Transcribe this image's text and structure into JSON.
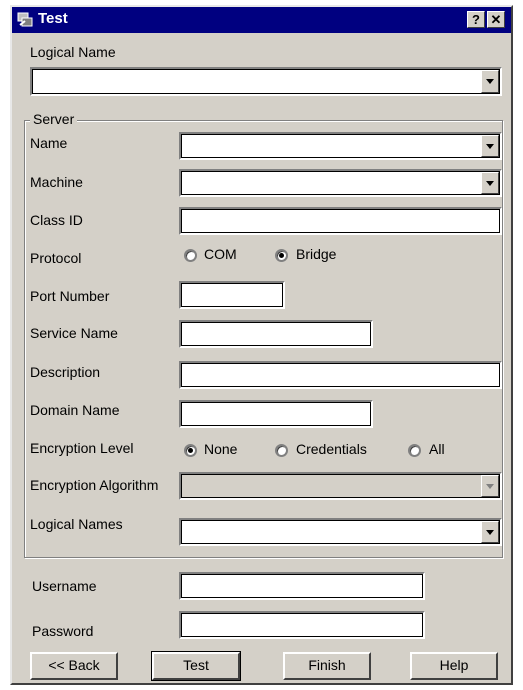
{
  "window": {
    "title": "Test",
    "help_button": "?",
    "close_button": "✕"
  },
  "logical_name": {
    "label": "Logical Name",
    "value": ""
  },
  "server": {
    "group_label": "Server",
    "name": {
      "label": "Name",
      "value": ""
    },
    "machine": {
      "label": "Machine",
      "value": ""
    },
    "class_id": {
      "label": "Class ID",
      "value": ""
    },
    "protocol": {
      "label": "Protocol",
      "options": [
        "COM",
        "Bridge"
      ],
      "selected": "Bridge"
    },
    "port_number": {
      "label": "Port Number",
      "value": ""
    },
    "service_name": {
      "label": "Service Name",
      "value": ""
    },
    "description": {
      "label": "Description",
      "value": ""
    },
    "domain_name": {
      "label": "Domain Name",
      "value": ""
    },
    "encryption_level": {
      "label": "Encryption Level",
      "options": [
        "None",
        "Credentials",
        "All"
      ],
      "selected": "None"
    },
    "encryption_algorithm": {
      "label": "Encryption Algorithm",
      "value": "",
      "enabled": false
    },
    "logical_names": {
      "label": "Logical Names",
      "value": ""
    }
  },
  "username": {
    "label": "Username",
    "value": ""
  },
  "password": {
    "label": "Password",
    "value": ""
  },
  "buttons": {
    "back": "<< Back",
    "test": "Test",
    "finish": "Finish",
    "help": "Help"
  },
  "colors": {
    "titlebar": "#000080",
    "dialog_bg": "#d4d0c8",
    "field_bg": "#ffffff"
  }
}
